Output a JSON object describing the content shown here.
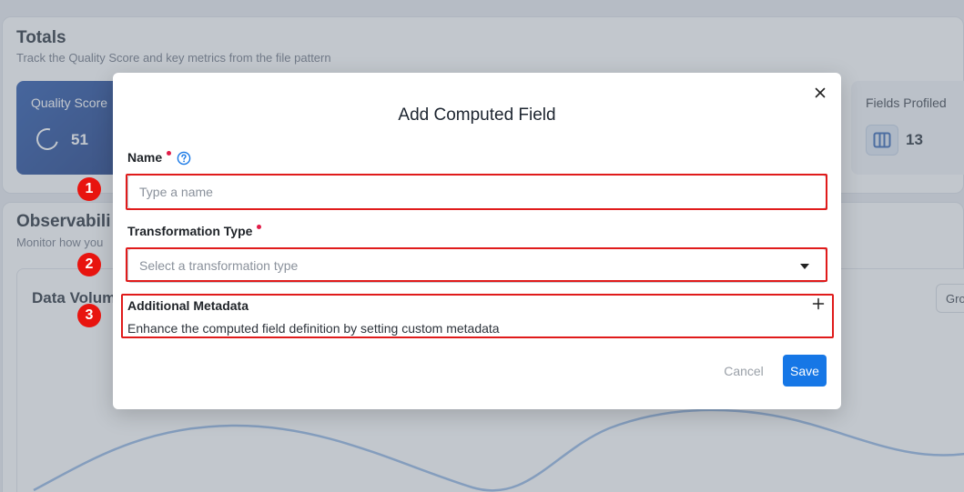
{
  "background": {
    "totals": {
      "title": "Totals",
      "subtitle": "Track the Quality Score and key metrics from the file pattern",
      "quality_score": {
        "label": "Quality Score",
        "value": "51"
      },
      "fields_profiled": {
        "label": "Fields Profiled",
        "value": "13"
      }
    },
    "observability": {
      "title": "Observabili",
      "subtitle": "Monitor how you",
      "data_volume": {
        "title": "Data Volum",
        "group_button": "Gro"
      }
    }
  },
  "modal": {
    "title": "Add Computed Field",
    "name_field": {
      "label": "Name",
      "placeholder": "Type a name",
      "value": ""
    },
    "transformation_field": {
      "label": "Transformation Type",
      "placeholder": "Select a transformation type"
    },
    "metadata": {
      "title": "Additional Metadata",
      "description": "Enhance the computed field definition by setting custom metadata"
    },
    "actions": {
      "cancel": "Cancel",
      "save": "Save"
    }
  },
  "annotations": {
    "badge_1": "1",
    "badge_2": "2",
    "badge_3": "3"
  },
  "colors": {
    "accent": "#1677e6",
    "required": "#e11d48",
    "highlight": "#e01b1b",
    "quality_card": "#1f4fa8"
  }
}
